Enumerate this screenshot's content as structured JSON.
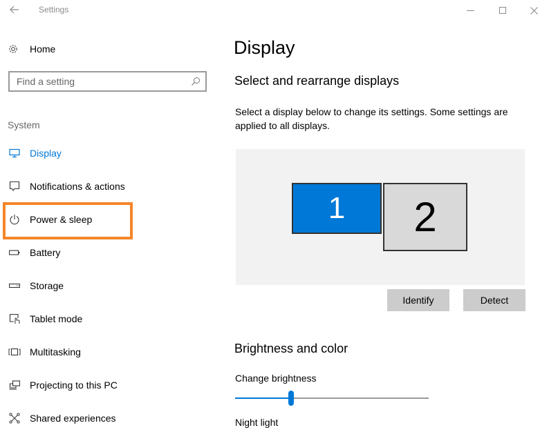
{
  "window": {
    "title": "Settings",
    "back_icon": "arrow-left-icon",
    "controls": [
      "minimize",
      "maximize",
      "close"
    ]
  },
  "sidebar": {
    "home_label": "Home",
    "search": {
      "value": "",
      "placeholder": "Find a setting"
    },
    "section_label": "System",
    "items": [
      {
        "label": "Display",
        "icon": "monitor-icon",
        "active": true
      },
      {
        "label": "Notifications & actions",
        "icon": "notification-icon",
        "active": false
      },
      {
        "label": "Power & sleep",
        "icon": "power-icon",
        "active": false,
        "highlighted": true
      },
      {
        "label": "Battery",
        "icon": "battery-icon",
        "active": false
      },
      {
        "label": "Storage",
        "icon": "storage-icon",
        "active": false
      },
      {
        "label": "Tablet mode",
        "icon": "tablet-mode-icon",
        "active": false
      },
      {
        "label": "Multitasking",
        "icon": "multitasking-icon",
        "active": false
      },
      {
        "label": "Projecting to this PC",
        "icon": "projecting-icon",
        "active": false
      },
      {
        "label": "Shared experiences",
        "icon": "shared-experiences-icon",
        "active": false
      }
    ]
  },
  "main": {
    "title": "Display",
    "arrange_heading": "Select and rearrange displays",
    "arrange_description": "Select a display below to change its settings. Some settings are applied to all displays.",
    "monitors": [
      {
        "label": "1",
        "selected": true
      },
      {
        "label": "2",
        "selected": false
      }
    ],
    "identify_label": "Identify",
    "detect_label": "Detect",
    "brightness_heading": "Brightness and color",
    "brightness_label": "Change brightness",
    "brightness_value_percent": 29,
    "night_light_label": "Night light"
  },
  "colors": {
    "accent": "#0078d7",
    "highlight_box": "#f5862a",
    "arrange_bg": "#f2f2f2",
    "button_bg": "#cccccc"
  }
}
